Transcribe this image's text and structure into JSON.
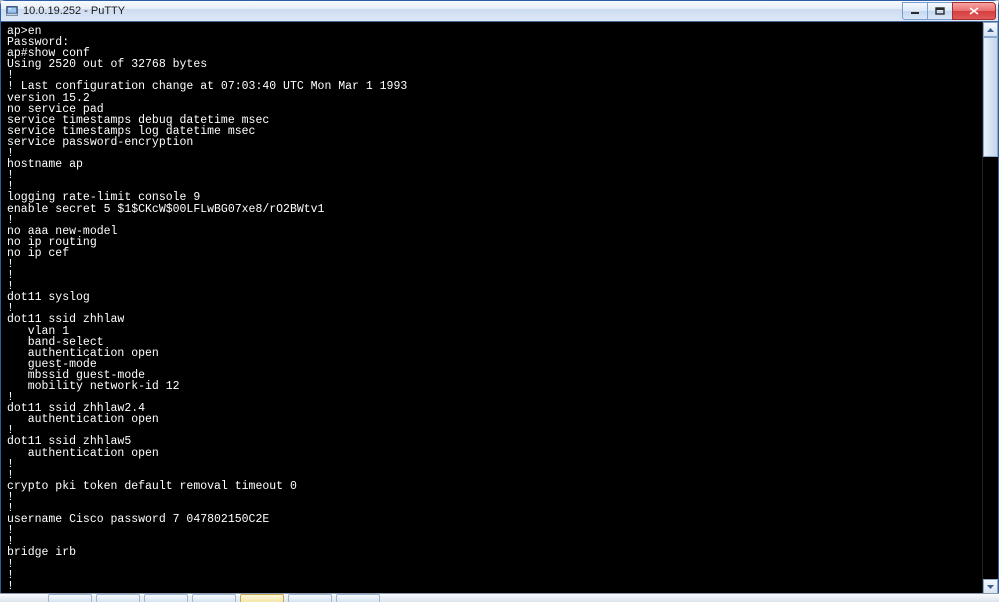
{
  "window": {
    "title": "10.0.19.252 - PuTTY"
  },
  "terminal": {
    "lines": [
      "ap>en",
      "Password:",
      "ap#show conf",
      "Using 2520 out of 32768 bytes",
      "!",
      "! Last configuration change at 07:03:40 UTC Mon Mar 1 1993",
      "version 15.2",
      "no service pad",
      "service timestamps debug datetime msec",
      "service timestamps log datetime msec",
      "service password-encryption",
      "!",
      "hostname ap",
      "!",
      "!",
      "logging rate-limit console 9",
      "enable secret 5 $1$CKcW$00LFLwBG07xe8/rO2BWtv1",
      "!",
      "no aaa new-model",
      "no ip routing",
      "no ip cef",
      "!",
      "!",
      "!",
      "dot11 syslog",
      "!",
      "dot11 ssid zhhlaw",
      "   vlan 1",
      "   band-select",
      "   authentication open",
      "   guest-mode",
      "   mbssid guest-mode",
      "   mobility network-id 12",
      "!",
      "dot11 ssid zhhlaw2.4",
      "   authentication open",
      "!",
      "dot11 ssid zhhlaw5",
      "   authentication open",
      "!",
      "!",
      "crypto pki token default removal timeout 0",
      "!",
      "!",
      "username Cisco password 7 047802150C2E",
      "!",
      "!",
      "bridge irb",
      "!",
      "!",
      "!"
    ]
  }
}
